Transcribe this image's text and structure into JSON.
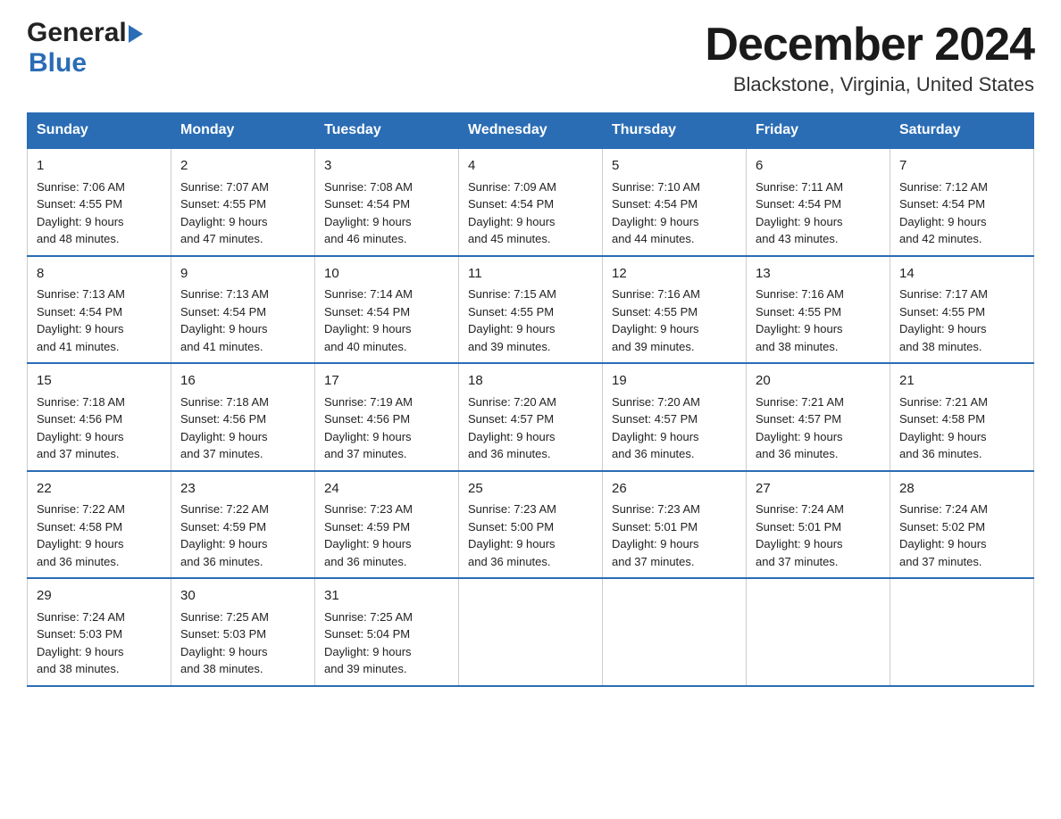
{
  "header": {
    "title": "December 2024",
    "subtitle": "Blackstone, Virginia, United States",
    "logo_general": "General",
    "logo_blue": "Blue"
  },
  "days_of_week": [
    "Sunday",
    "Monday",
    "Tuesday",
    "Wednesday",
    "Thursday",
    "Friday",
    "Saturday"
  ],
  "weeks": [
    [
      {
        "day": "1",
        "sunrise": "7:06 AM",
        "sunset": "4:55 PM",
        "daylight": "9 hours and 48 minutes."
      },
      {
        "day": "2",
        "sunrise": "7:07 AM",
        "sunset": "4:55 PM",
        "daylight": "9 hours and 47 minutes."
      },
      {
        "day": "3",
        "sunrise": "7:08 AM",
        "sunset": "4:54 PM",
        "daylight": "9 hours and 46 minutes."
      },
      {
        "day": "4",
        "sunrise": "7:09 AM",
        "sunset": "4:54 PM",
        "daylight": "9 hours and 45 minutes."
      },
      {
        "day": "5",
        "sunrise": "7:10 AM",
        "sunset": "4:54 PM",
        "daylight": "9 hours and 44 minutes."
      },
      {
        "day": "6",
        "sunrise": "7:11 AM",
        "sunset": "4:54 PM",
        "daylight": "9 hours and 43 minutes."
      },
      {
        "day": "7",
        "sunrise": "7:12 AM",
        "sunset": "4:54 PM",
        "daylight": "9 hours and 42 minutes."
      }
    ],
    [
      {
        "day": "8",
        "sunrise": "7:13 AM",
        "sunset": "4:54 PM",
        "daylight": "9 hours and 41 minutes."
      },
      {
        "day": "9",
        "sunrise": "7:13 AM",
        "sunset": "4:54 PM",
        "daylight": "9 hours and 41 minutes."
      },
      {
        "day": "10",
        "sunrise": "7:14 AM",
        "sunset": "4:54 PM",
        "daylight": "9 hours and 40 minutes."
      },
      {
        "day": "11",
        "sunrise": "7:15 AM",
        "sunset": "4:55 PM",
        "daylight": "9 hours and 39 minutes."
      },
      {
        "day": "12",
        "sunrise": "7:16 AM",
        "sunset": "4:55 PM",
        "daylight": "9 hours and 39 minutes."
      },
      {
        "day": "13",
        "sunrise": "7:16 AM",
        "sunset": "4:55 PM",
        "daylight": "9 hours and 38 minutes."
      },
      {
        "day": "14",
        "sunrise": "7:17 AM",
        "sunset": "4:55 PM",
        "daylight": "9 hours and 38 minutes."
      }
    ],
    [
      {
        "day": "15",
        "sunrise": "7:18 AM",
        "sunset": "4:56 PM",
        "daylight": "9 hours and 37 minutes."
      },
      {
        "day": "16",
        "sunrise": "7:18 AM",
        "sunset": "4:56 PM",
        "daylight": "9 hours and 37 minutes."
      },
      {
        "day": "17",
        "sunrise": "7:19 AM",
        "sunset": "4:56 PM",
        "daylight": "9 hours and 37 minutes."
      },
      {
        "day": "18",
        "sunrise": "7:20 AM",
        "sunset": "4:57 PM",
        "daylight": "9 hours and 36 minutes."
      },
      {
        "day": "19",
        "sunrise": "7:20 AM",
        "sunset": "4:57 PM",
        "daylight": "9 hours and 36 minutes."
      },
      {
        "day": "20",
        "sunrise": "7:21 AM",
        "sunset": "4:57 PM",
        "daylight": "9 hours and 36 minutes."
      },
      {
        "day": "21",
        "sunrise": "7:21 AM",
        "sunset": "4:58 PM",
        "daylight": "9 hours and 36 minutes."
      }
    ],
    [
      {
        "day": "22",
        "sunrise": "7:22 AM",
        "sunset": "4:58 PM",
        "daylight": "9 hours and 36 minutes."
      },
      {
        "day": "23",
        "sunrise": "7:22 AM",
        "sunset": "4:59 PM",
        "daylight": "9 hours and 36 minutes."
      },
      {
        "day": "24",
        "sunrise": "7:23 AM",
        "sunset": "4:59 PM",
        "daylight": "9 hours and 36 minutes."
      },
      {
        "day": "25",
        "sunrise": "7:23 AM",
        "sunset": "5:00 PM",
        "daylight": "9 hours and 36 minutes."
      },
      {
        "day": "26",
        "sunrise": "7:23 AM",
        "sunset": "5:01 PM",
        "daylight": "9 hours and 37 minutes."
      },
      {
        "day": "27",
        "sunrise": "7:24 AM",
        "sunset": "5:01 PM",
        "daylight": "9 hours and 37 minutes."
      },
      {
        "day": "28",
        "sunrise": "7:24 AM",
        "sunset": "5:02 PM",
        "daylight": "9 hours and 37 minutes."
      }
    ],
    [
      {
        "day": "29",
        "sunrise": "7:24 AM",
        "sunset": "5:03 PM",
        "daylight": "9 hours and 38 minutes."
      },
      {
        "day": "30",
        "sunrise": "7:25 AM",
        "sunset": "5:03 PM",
        "daylight": "9 hours and 38 minutes."
      },
      {
        "day": "31",
        "sunrise": "7:25 AM",
        "sunset": "5:04 PM",
        "daylight": "9 hours and 39 minutes."
      },
      null,
      null,
      null,
      null
    ]
  ],
  "labels": {
    "sunrise": "Sunrise:",
    "sunset": "Sunset:",
    "daylight": "Daylight:"
  }
}
